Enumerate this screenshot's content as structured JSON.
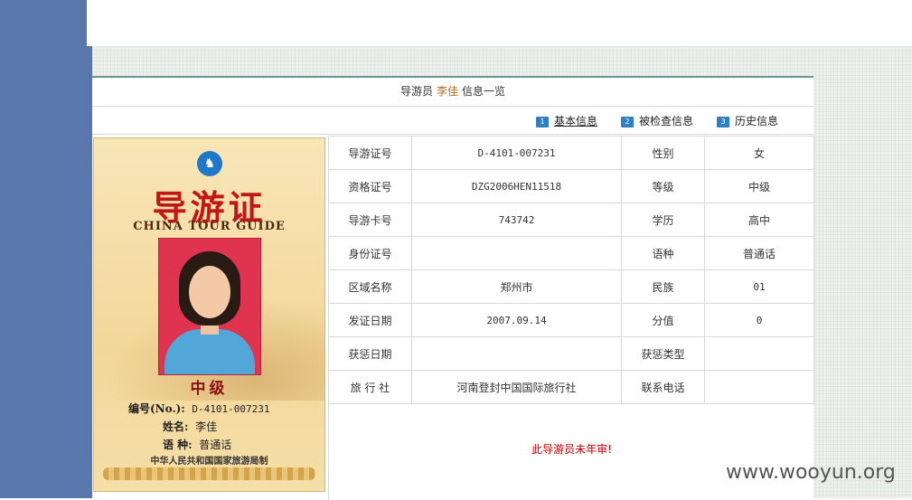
{
  "header": {
    "prefix": "导游员",
    "name": "李佳",
    "suffix": "信息一览"
  },
  "tabs": [
    {
      "num": "1",
      "label": "基本信息",
      "active": true
    },
    {
      "num": "2",
      "label": "被检查信息",
      "active": false
    },
    {
      "num": "3",
      "label": "历史信息",
      "active": false
    }
  ],
  "card": {
    "logo_icon": "horse-logo-icon",
    "title": "导游证",
    "subtitle": "CHINA TOUR GUIDE",
    "level": "中级",
    "no_label": "编号(No.):",
    "no_value": "D-4101-007231",
    "name_label": "姓名:",
    "name_value": "李佳",
    "lang_label": "语 种:",
    "lang_value": "普通话",
    "issuer": "中华人民共和国国家旅游局制"
  },
  "table": {
    "rows": [
      {
        "l1": "导游证号",
        "v1": "D-4101-007231",
        "l2": "性别",
        "v2": "女"
      },
      {
        "l1": "资格证号",
        "v1": "DZG2006HEN11518",
        "l2": "等级",
        "v2": "中级"
      },
      {
        "l1": "导游卡号",
        "v1": "743742",
        "l2": "学历",
        "v2": "高中"
      },
      {
        "l1": "身份证号",
        "v1": "",
        "l2": "语种",
        "v2": "普通话"
      },
      {
        "l1": "区域名称",
        "v1": "郑州市",
        "l2": "民族",
        "v2": "01"
      },
      {
        "l1": "发证日期",
        "v1": "2007.09.14",
        "l2": "分值",
        "v2": "0"
      },
      {
        "l1": "获惩日期",
        "v1": "",
        "l2": "获惩类型",
        "v2": ""
      },
      {
        "l1": "旅 行 社",
        "v1": "河南登封中国国际旅行社",
        "l2": "联系电话",
        "v2": ""
      }
    ]
  },
  "notice": "此导游员未年审!",
  "watermark": "www.wooyun.org",
  "colors": {
    "sidebar": "#5a77ad",
    "accent_name": "#b5681b",
    "notice": "#cc0000",
    "tab_icon": "#2e7fc4"
  }
}
